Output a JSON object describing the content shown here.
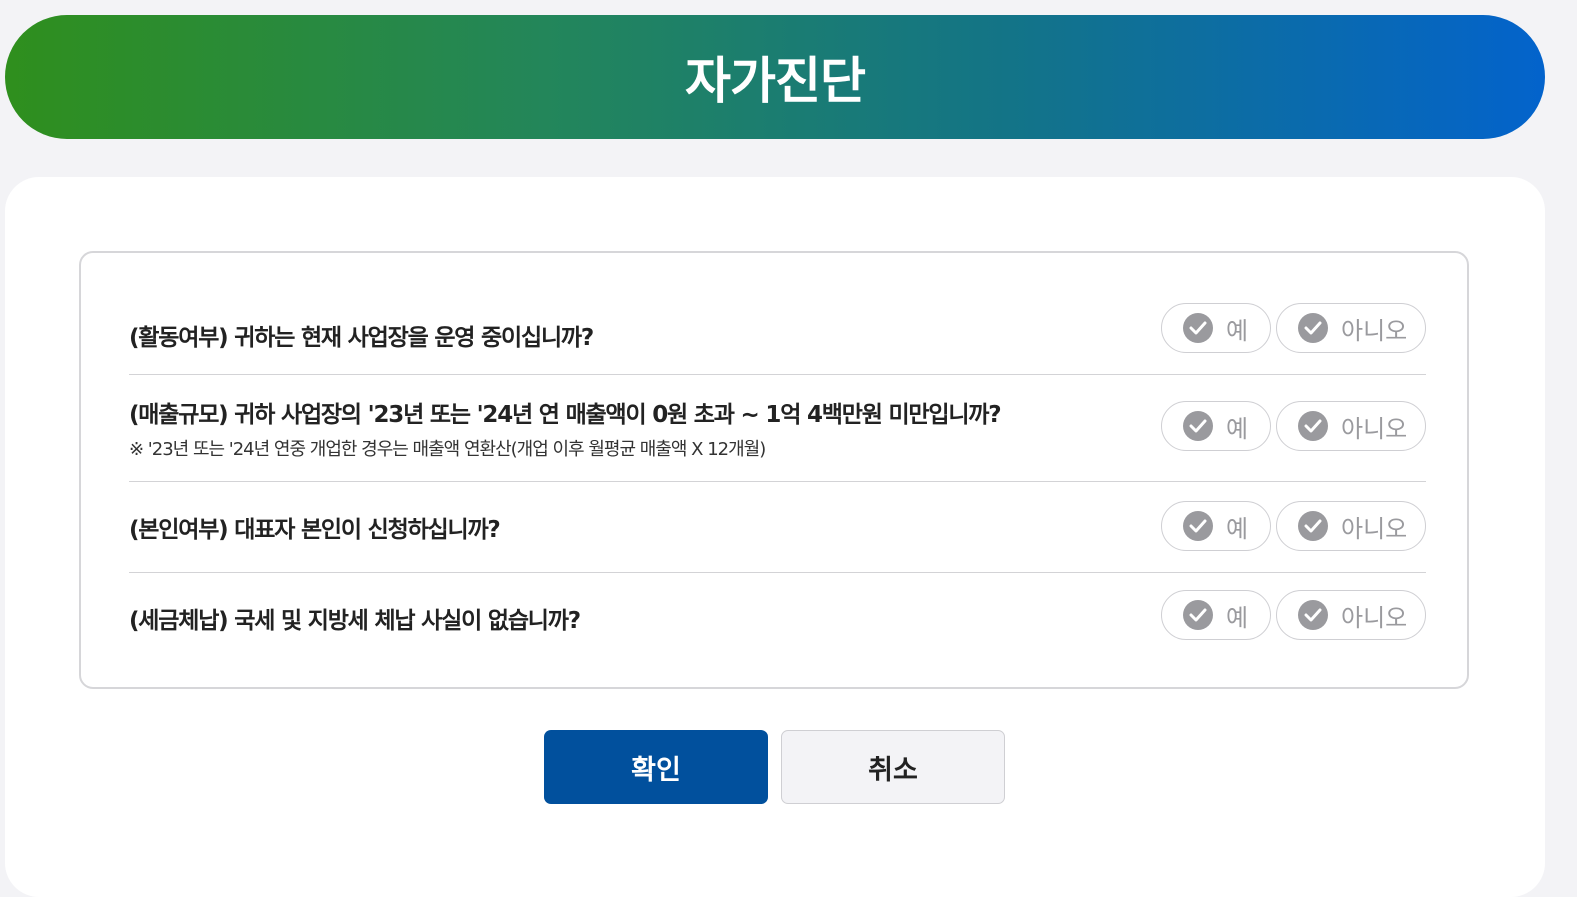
{
  "header": {
    "title": "자가진단"
  },
  "questions": [
    {
      "text": "(활동여부) 귀하는 현재 사업장을 운영 중이십니까?",
      "note": null
    },
    {
      "text": "(매출규모) 귀하 사업장의 '23년 또는 '24년 연 매출액이 0원 초과 ~ 1억 4백만원 미만입니까?",
      "note": "※ '23년 또는 '24년 연중 개업한 경우는 매출액 연환산(개업 이후 월평균 매출액 X 12개월)"
    },
    {
      "text": "(본인여부) 대표자 본인이 신청하십니까?",
      "note": null
    },
    {
      "text": "(세금체납) 국세 및 지방세 체납 사실이 없습니까?",
      "note": null
    }
  ],
  "options": {
    "yes_label": "예",
    "no_label": "아니오",
    "check_icon": "check-circle-icon",
    "inactive_color": "#9a9a9e"
  },
  "buttons": {
    "confirm_label": "확인",
    "cancel_label": "취소",
    "confirm_color": "#01509d"
  }
}
